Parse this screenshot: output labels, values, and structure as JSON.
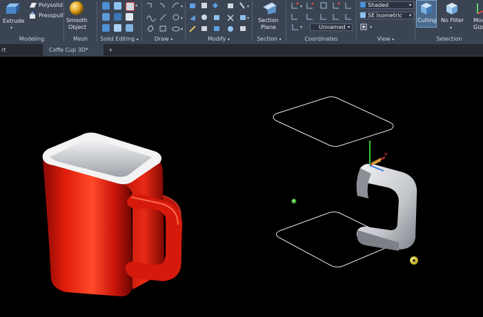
{
  "ribbon": {
    "modeling": {
      "title": "Modeling",
      "extrude": "Extrude",
      "polysolid": "Polysolid",
      "presspull": "Presspull"
    },
    "mesh": {
      "title": "Mesh",
      "smooth_line1": "Smooth",
      "smooth_line2": "Object"
    },
    "solid_editing": {
      "title": "Solid Editing"
    },
    "draw": {
      "title": "Draw"
    },
    "modify": {
      "title": "Modify"
    },
    "section": {
      "title": "Section",
      "line1": "Section",
      "line2": "Plane"
    },
    "coordinates": {
      "title": "Coordinates",
      "ucs": "Unnamed"
    },
    "view": {
      "title": "View",
      "visual_style": "Shaded",
      "view_direction": "SE Isometric"
    },
    "selection": {
      "title": "Selection",
      "culling": "Culling",
      "filter_line1": "No Filter",
      "gizmo_line1": "Move",
      "gizmo_line2": "Gizmo"
    }
  },
  "tabs": {
    "start_fragment": "rt",
    "active": "Coffe Cup 3D*",
    "add": "+"
  },
  "colors": {
    "ribbon": "#3b4453",
    "cup_red": "#d8150a",
    "handle_gray": "#c9ccd1",
    "viewport": "#000000"
  },
  "icons": [
    "extrude-icon",
    "polysolid-icon",
    "presspull-icon",
    "smooth-object-icon",
    "section-plane-icon",
    "culling-icon",
    "no-filter-icon",
    "move-gizmo-icon",
    "ucs-icon",
    "light-bulb-icon"
  ]
}
